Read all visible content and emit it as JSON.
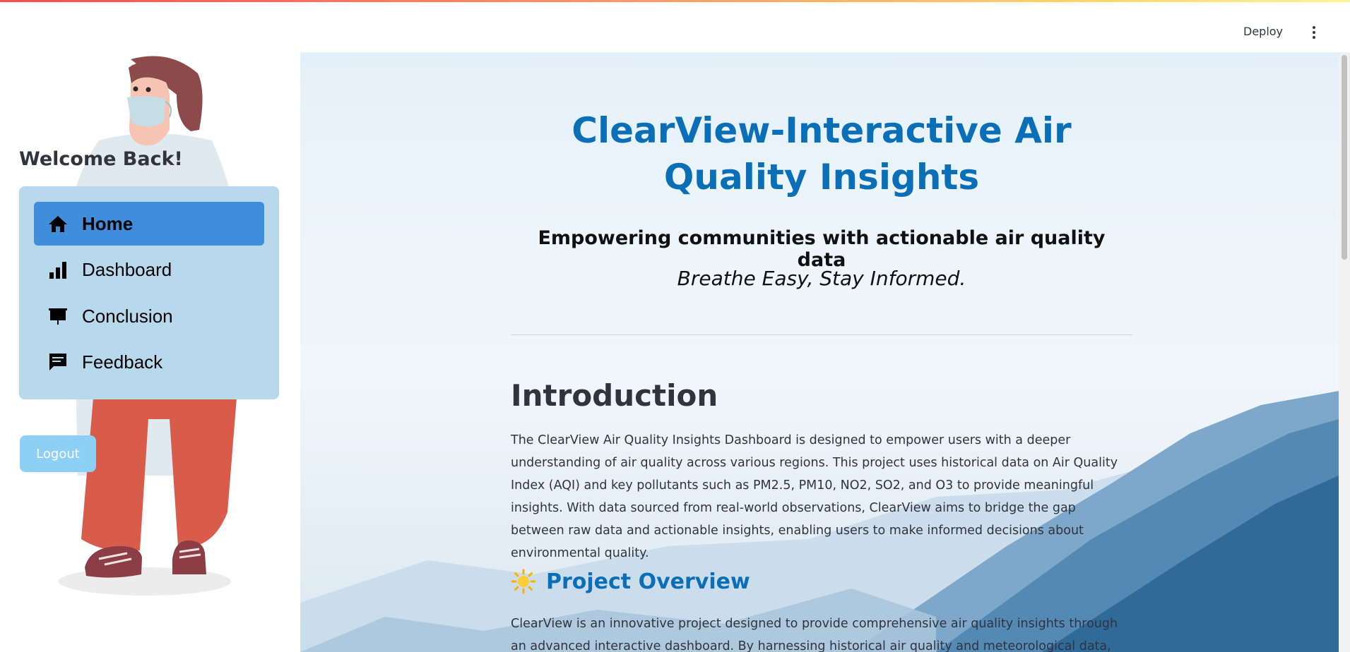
{
  "header": {
    "deploy_label": "Deploy",
    "menu_icon": "vertical-ellipsis-icon"
  },
  "sidebar": {
    "welcome": "Welcome Back!",
    "illustration": "woman-with-face-mask",
    "nav": [
      {
        "label": "Home",
        "icon": "home-icon",
        "active": true
      },
      {
        "label": "Dashboard",
        "icon": "bar-chart-icon",
        "active": false
      },
      {
        "label": "Conclusion",
        "icon": "presentation-icon",
        "active": false
      },
      {
        "label": "Feedback",
        "icon": "chat-icon",
        "active": false
      }
    ],
    "logout_label": "Logout"
  },
  "main": {
    "title": "ClearView-Interactive Air Quality Insights",
    "subtitle": "Empowering communities with actionable air quality data",
    "tagline": "Breathe Easy, Stay Informed.",
    "intro_heading": "Introduction",
    "intro_text": "The ClearView Air Quality Insights Dashboard is designed to empower users with a deeper understanding of air quality across various regions. This project uses historical data on Air Quality Index (AQI) and key pollutants such as PM2.5, PM10, NO2, SO2, and O3 to provide meaningful insights. With data sourced from real-world observations, ClearView aims to bridge the gap between raw data and actionable insights, enabling users to make informed decisions about environmental quality.",
    "overview_icon": "sun-icon",
    "overview_heading": "Project Overview",
    "overview_text": "ClearView is an innovative project designed to provide comprehensive air quality insights through an advanced interactive dashboard. By harnessing historical air quality and meteorological data, ClearView"
  },
  "colors": {
    "accent": "#0b6fb8",
    "nav_active": "#3f8ddb",
    "nav_card": "#b8d9ec",
    "logout": "#8dcff5"
  }
}
